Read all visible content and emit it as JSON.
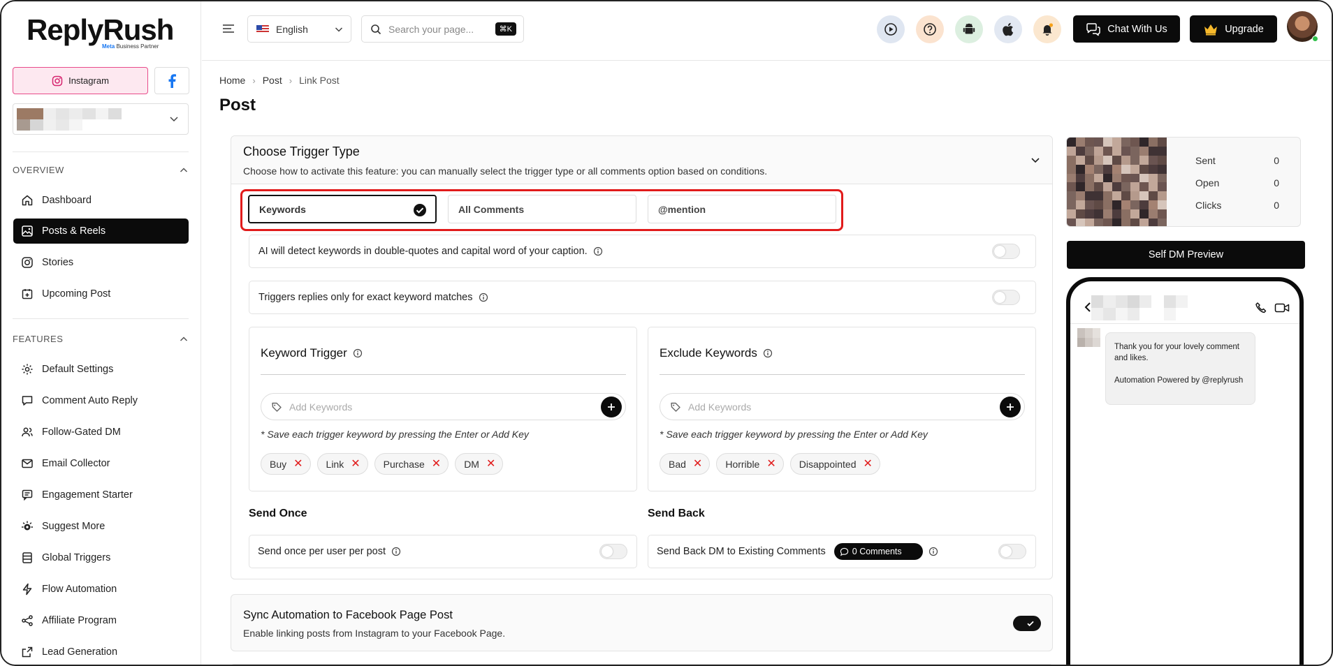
{
  "sidebar": {
    "logo": "ReplyRush",
    "logo_sub_prefix": "Meta",
    "logo_sub_rest": "Business Partner",
    "platform_instagram": "Instagram",
    "sections": {
      "overview": "OVERVIEW",
      "features": "FEATURES"
    },
    "overview_items": [
      "Dashboard",
      "Posts & Reels",
      "Stories",
      "Upcoming Post"
    ],
    "feature_items": [
      "Default Settings",
      "Comment Auto Reply",
      "Follow-Gated DM",
      "Email Collector",
      "Engagement Starter",
      "Suggest More",
      "Global Triggers",
      "Flow Automation",
      "Affiliate Program",
      "Lead Generation"
    ],
    "active_item": "Posts & Reels"
  },
  "topbar": {
    "language": "English",
    "search_placeholder": "Search your page...",
    "search_shortcut": "⌘K",
    "chat_label": "Chat With Us",
    "upgrade_label": "Upgrade"
  },
  "breadcrumb": [
    "Home",
    "Post",
    "Link Post"
  ],
  "page_title": "Post",
  "trigger": {
    "title": "Choose Trigger Type",
    "description": "Choose how to activate this feature: you can manually select the trigger type or all comments option based on conditions.",
    "options": [
      "Keywords",
      "All Comments",
      "@mention"
    ],
    "selected": "Keywords",
    "ai_detect_label": "AI will detect keywords in double-quotes and capital word of your caption.",
    "exact_match_label": "Triggers replies only for exact keyword matches",
    "keyword_trigger": {
      "title": "Keyword Trigger",
      "placeholder": "Add Keywords",
      "hint": "* Save each trigger keyword by pressing the Enter or Add Key",
      "keywords": [
        "Buy",
        "Link",
        "Purchase",
        "DM"
      ]
    },
    "exclude_keywords": {
      "title": "Exclude Keywords",
      "placeholder": "Add Keywords",
      "hint": "* Save each trigger keyword by pressing the Enter or Add Key",
      "keywords": [
        "Bad",
        "Horrible",
        "Disappointed"
      ]
    },
    "send_once": {
      "title": "Send Once",
      "label": "Send once per user per post"
    },
    "send_back": {
      "title": "Send Back",
      "label": "Send Back DM to Existing Comments",
      "badge": "0 Comments"
    }
  },
  "sync": {
    "title": "Sync Automation to Facebook Page Post",
    "description": "Enable linking posts from Instagram to your Facebook Page.",
    "enabled": true
  },
  "stats": [
    {
      "label": "Sent",
      "value": "0"
    },
    {
      "label": "Open",
      "value": "0"
    },
    {
      "label": "Clicks",
      "value": "0"
    }
  ],
  "preview": {
    "button": "Self DM Preview",
    "message": "Thank you for your lovely comment and likes.\n\nAutomation Powered by @replyrush"
  },
  "colors": {
    "accent": "#0b0b0b",
    "highlight_outline": "#e11b1b",
    "instagram_tint": "#fde8f0",
    "online": "#2fbf4a"
  }
}
